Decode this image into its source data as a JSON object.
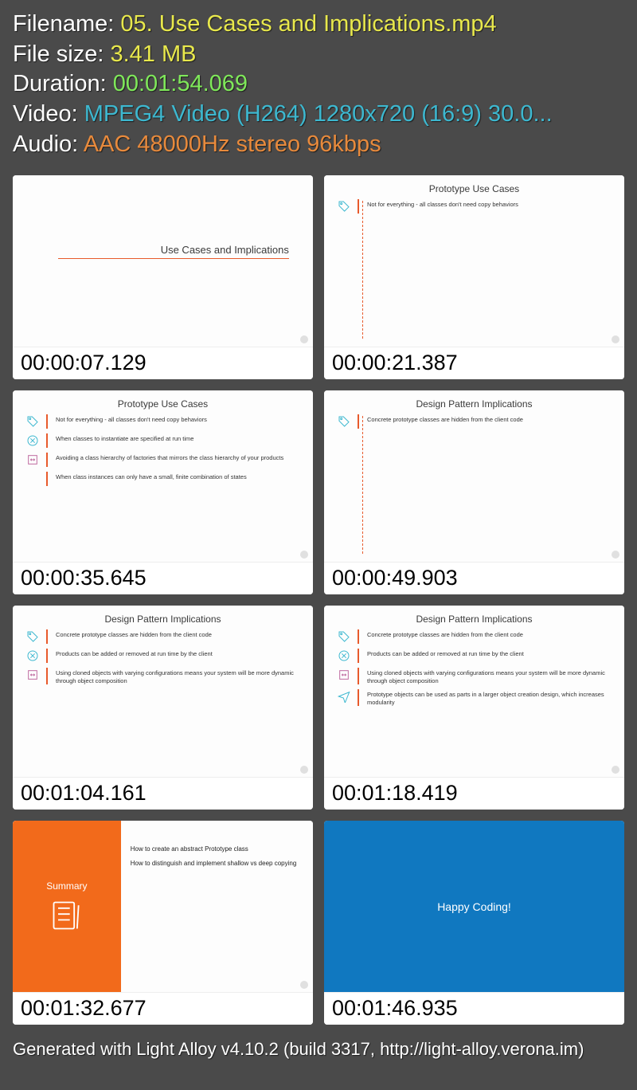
{
  "header": {
    "labels": {
      "filename": "Filename: ",
      "filesize": "File size: ",
      "duration": "Duration: ",
      "video": "Video: ",
      "audio": "Audio: "
    },
    "filename": "05. Use Cases and Implications.mp4",
    "filesize": "3.41 MB",
    "duration": "00:01:54.069",
    "video": "MPEG4 Video (H264) 1280x720 (16:9) 30.0...",
    "audio": "AAC 48000Hz stereo 96kbps"
  },
  "thumbs": [
    {
      "timecode": "00:00:07.129",
      "title": "Use Cases and Implications"
    },
    {
      "timecode": "00:00:21.387",
      "title": "Prototype Use Cases",
      "bullets": [
        "Not for everything - all classes don't need copy behaviors"
      ]
    },
    {
      "timecode": "00:00:35.645",
      "title": "Prototype Use Cases",
      "bullets": [
        "Not for everything - all classes don't need copy behaviors",
        "When classes to instantiate are specified at run time",
        "Avoiding a class hierarchy of factories that mirrors the class hierarchy of your products",
        "When class instances can only have a small, finite combination of states"
      ]
    },
    {
      "timecode": "00:00:49.903",
      "title": "Design Pattern Implications",
      "bullets": [
        "Concrete prototype classes are hidden from the client code"
      ]
    },
    {
      "timecode": "00:01:04.161",
      "title": "Design Pattern Implications",
      "bullets": [
        "Concrete prototype classes are hidden from the client code",
        "Products can be added or removed at run time by the client",
        "Using cloned objects with varying configurations means your system will be more dynamic through object composition"
      ]
    },
    {
      "timecode": "00:01:18.419",
      "title": "Design Pattern Implications",
      "bullets": [
        "Concrete prototype classes are hidden from the client code",
        "Products can be added or removed at run time by the client",
        "Using cloned objects with varying configurations means your system will be more dynamic through object composition",
        "Prototype objects can be used as parts in a larger object creation design, which increases modularity"
      ]
    },
    {
      "timecode": "00:01:32.677",
      "summary_title": "Summary",
      "summary_points": [
        "How to create an abstract Prototype class",
        "How to distinguish and implement shallow vs deep copying"
      ]
    },
    {
      "timecode": "00:01:46.935",
      "happy": "Happy Coding!"
    }
  ],
  "footer": "Generated with Light Alloy v4.10.2 (build 3317, http://light-alloy.verona.im)"
}
